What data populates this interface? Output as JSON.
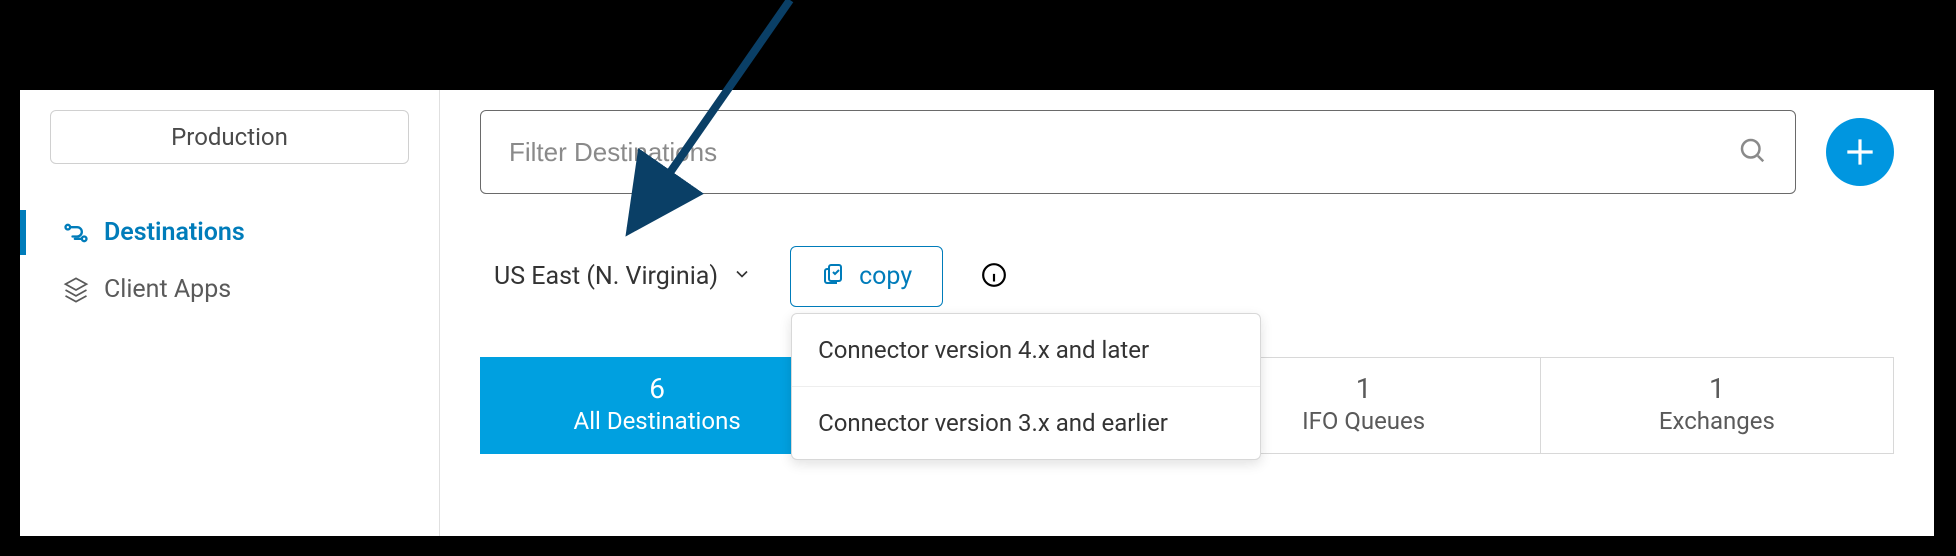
{
  "sidebar": {
    "env": "Production",
    "items": [
      {
        "label": "Destinations",
        "active": true
      },
      {
        "label": "Client Apps",
        "active": false
      }
    ]
  },
  "search": {
    "placeholder": "Filter Destinations",
    "value": ""
  },
  "region": {
    "label": "US East (N. Virginia)"
  },
  "copy": {
    "label": "copy",
    "menu": [
      "Connector version 4.x and later",
      "Connector version 3.x and earlier"
    ]
  },
  "tabs": [
    {
      "count": "6",
      "label": "All Destinations",
      "active": true
    },
    {
      "count": "",
      "label": "",
      "active": false
    },
    {
      "count": "1",
      "label": "IFO Queues",
      "active": false
    },
    {
      "count": "1",
      "label": "Exchanges",
      "active": false
    }
  ]
}
